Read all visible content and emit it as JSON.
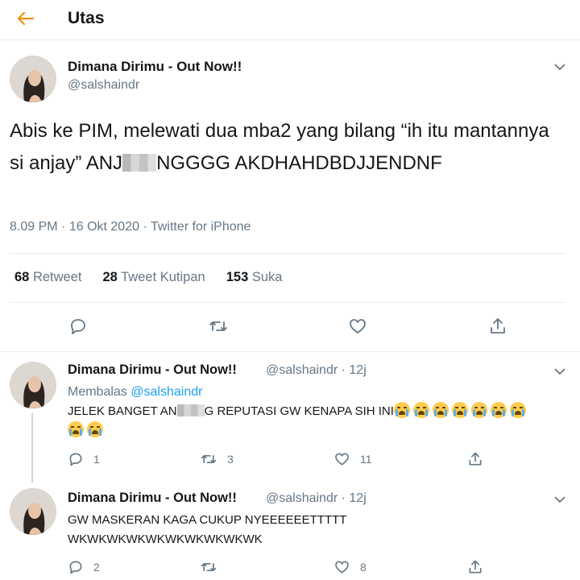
{
  "header": {
    "title": "Utas"
  },
  "main_tweet": {
    "name": "Dimana Dirimu - Out Now!!",
    "handle": "@salshaindr",
    "text_part1": "Abis ke PIM, melewati dua mba2 yang bilang “ih itu mantannya si anjay” ANJ",
    "text_part2": "NGGGG AKDHAHDBDJJENDNF",
    "time": "8.09 PM",
    "date": "16 Okt 2020",
    "source": "Twitter for iPhone",
    "retweet_count": "68",
    "retweet_label": "Retweet",
    "quote_count": "28",
    "quote_label": "Tweet Kutipan",
    "like_count": "153",
    "like_label": "Suka"
  },
  "replies": [
    {
      "name": "Dimana Dirimu - Out Now!!",
      "handle": "@salshaindr",
      "age": "12j",
      "replying_label": "Membalas",
      "replying_to": "@salshaindr",
      "text_part1": "JELEK BANGET AN",
      "text_part2": "G REPUTASI GW KENAPA SIH INI",
      "emoji": "loudly-crying-face",
      "reply_count": "1",
      "retweet_count": "3",
      "like_count": "11"
    },
    {
      "name": "Dimana Dirimu - Out Now!!",
      "handle": "@salshaindr",
      "age": "12j",
      "text_line1": "GW MASKERAN KAGA CUKUP NYEEEEEETTTTT",
      "text_line2": "WKWKWKWKWKWKWKWKWKWK",
      "reply_count": "2",
      "retweet_count": "",
      "like_count": "8"
    }
  ],
  "colors": {
    "accent": "#1da1f2",
    "back_arrow": "#f4900c",
    "muted": "#657786",
    "border": "#e6ecf0"
  },
  "icons": [
    "back-arrow-icon",
    "chevron-down-icon",
    "reply-icon",
    "retweet-icon",
    "like-icon",
    "share-icon"
  ]
}
